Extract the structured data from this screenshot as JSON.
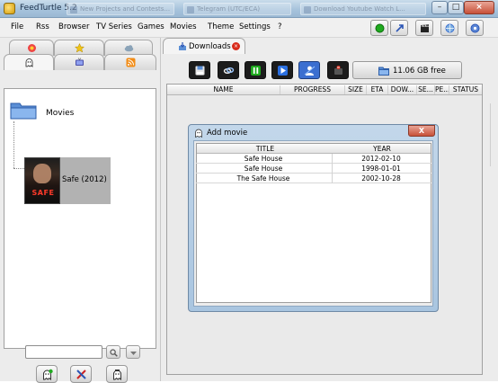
{
  "window": {
    "title": "FeedTurtle 5.2",
    "background_tabs": [
      "New Projects and Contests...",
      "Telegram (UTC/ECA)",
      "Download Youtube Watch L..."
    ]
  },
  "menu": {
    "items": [
      "File",
      "Rss",
      "Browser",
      "TV Series",
      "Games",
      "Movies",
      "Theme",
      "Settings",
      "?"
    ]
  },
  "toolbar_icons": [
    "status-green-icon",
    "arrow-icon",
    "clapperboard-icon",
    "globe-icon",
    "help-icon"
  ],
  "categories": {
    "row1": [
      "rss-badge-icon",
      "star-icon",
      "cloud-icon"
    ],
    "row2": [
      "ghost-icon",
      "tv-icon",
      "rss-icon"
    ]
  },
  "library": {
    "folder_label": "Movies",
    "items": [
      {
        "label": "Safe (2012)",
        "poster_title": "SAFE"
      }
    ]
  },
  "search": {
    "value": "",
    "placeholder": ""
  },
  "downloads": {
    "tab_label": "Downloads",
    "free_space": "11.06 GB free",
    "columns": [
      "NAME",
      "PROGRESS",
      "SIZE",
      "ETA",
      "DOW...",
      "SE...",
      "PE...",
      "STATUS"
    ]
  },
  "dialog": {
    "title": "Add movie",
    "close_label": "X",
    "columns": [
      "TITLE",
      "YEAR"
    ],
    "rows": [
      {
        "title": "Safe House",
        "year": "2012-02-10"
      },
      {
        "title": "Safe House",
        "year": "1998-01-01"
      },
      {
        "title": "The Safe House",
        "year": "2002-10-28"
      }
    ]
  },
  "colors": {
    "accent_blue": "#3b6fd0",
    "status_green": "#1faa1f",
    "close_red": "#c75038"
  }
}
